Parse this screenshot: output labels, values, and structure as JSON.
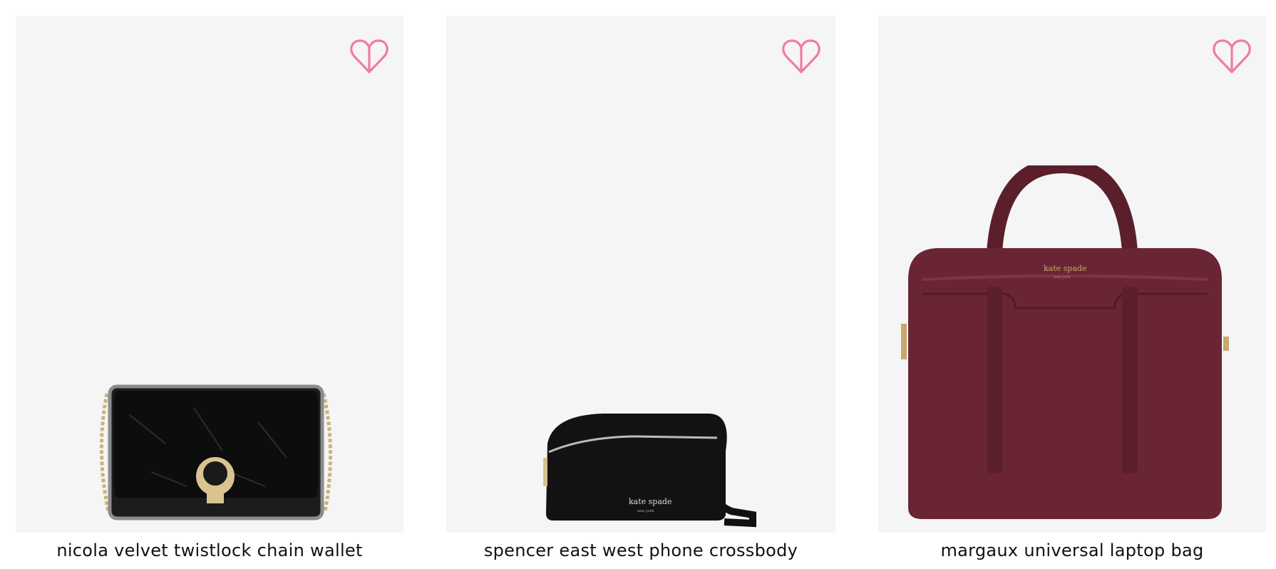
{
  "colors": {
    "card_background": "#f5f5f5",
    "heart_outline": "#f07aa8",
    "text": "#111111"
  },
  "products": [
    {
      "name": "nicola velvet twistlock chain wallet",
      "icon": "heart-outline-icon",
      "image_icon": "black-velvet-chain-wallet-image"
    },
    {
      "name": "spencer east west phone crossbody",
      "icon": "heart-outline-icon",
      "image_icon": "black-crossbody-bag-image",
      "brand_stamp": "kate spade",
      "brand_stamp_sub": "new york"
    },
    {
      "name": "margaux universal laptop bag",
      "icon": "heart-outline-icon",
      "image_icon": "burgundy-laptop-bag-image",
      "brand_stamp": "kate spade",
      "brand_stamp_sub": "new york"
    }
  ]
}
